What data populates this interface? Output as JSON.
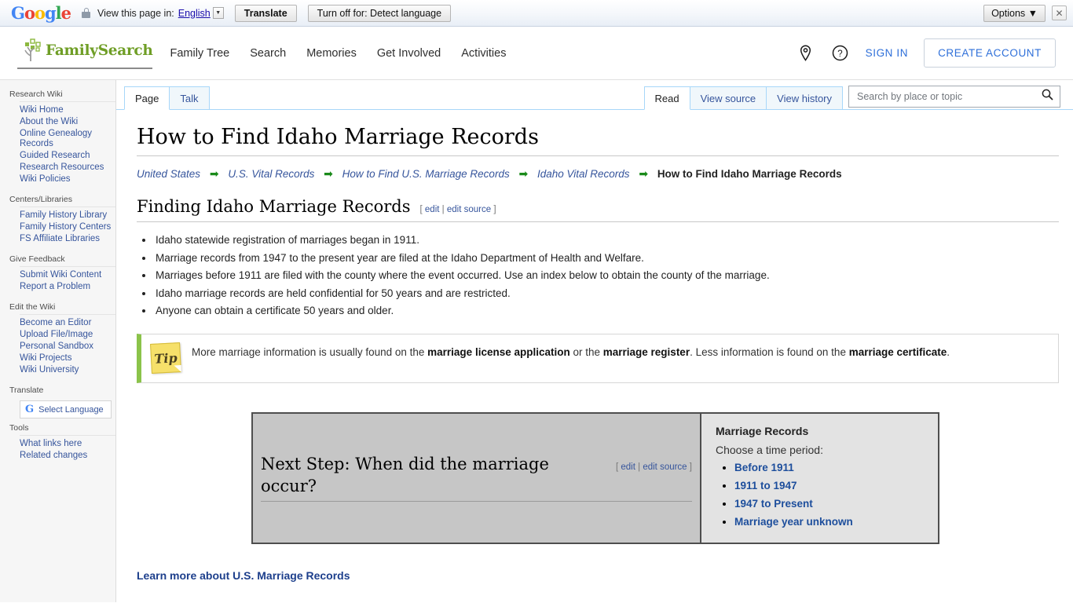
{
  "translate_bar": {
    "google_logo": "Google",
    "lock_icon": "lock-icon",
    "view_label": "View this page in:",
    "language": "English",
    "translate_button": "Translate",
    "turnoff_button": "Turn off for: Detect language",
    "options_button": "Options ▼",
    "close_icon": "✕"
  },
  "header": {
    "brand": "FamilySearch",
    "nav": [
      {
        "label": "Family Tree"
      },
      {
        "label": "Search"
      },
      {
        "label": "Memories"
      },
      {
        "label": "Get Involved"
      },
      {
        "label": "Activities"
      }
    ],
    "location_icon": "map-pin-icon",
    "help_icon": "help-circle-icon",
    "sign_in": "SIGN IN",
    "create_account": "CREATE ACCOUNT"
  },
  "sidebar": {
    "groups": [
      {
        "title": "Research Wiki",
        "items": [
          {
            "label": "Wiki Home"
          },
          {
            "label": "About the Wiki"
          },
          {
            "label": "Online Genealogy Records"
          },
          {
            "label": "Guided Research"
          },
          {
            "label": "Research Resources"
          },
          {
            "label": "Wiki Policies"
          }
        ]
      },
      {
        "title": "Centers/Libraries",
        "items": [
          {
            "label": "Family History Library"
          },
          {
            "label": "Family History Centers"
          },
          {
            "label": "FS Affiliate Libraries"
          }
        ]
      },
      {
        "title": "Give Feedback",
        "items": [
          {
            "label": "Submit Wiki Content"
          },
          {
            "label": "Report a Problem"
          }
        ]
      },
      {
        "title": "Edit the Wiki",
        "items": [
          {
            "label": "Become an Editor"
          },
          {
            "label": "Upload File/Image"
          },
          {
            "label": "Personal Sandbox"
          },
          {
            "label": "Wiki Projects"
          },
          {
            "label": "Wiki University"
          }
        ]
      }
    ],
    "translate_title": "Translate",
    "select_language": "Select Language",
    "google_glyph": "G",
    "tools_title": "Tools",
    "tools_items": [
      {
        "label": "What links here"
      },
      {
        "label": "Related changes"
      }
    ]
  },
  "tabs": {
    "left": [
      {
        "label": "Page",
        "active": true
      },
      {
        "label": "Talk",
        "active": false
      }
    ],
    "right": [
      {
        "label": "Read",
        "active": true
      },
      {
        "label": "View source",
        "active": false
      },
      {
        "label": "View history",
        "active": false
      }
    ]
  },
  "search": {
    "placeholder": "Search by place or topic",
    "value": "",
    "icon": "search-icon"
  },
  "main": {
    "page_title": "How to Find Idaho Marriage Records",
    "breadcrumb": [
      {
        "label": "United States",
        "current": false
      },
      {
        "label": "U.S. Vital Records",
        "current": false
      },
      {
        "label": "How to Find U.S. Marriage Records",
        "current": false
      },
      {
        "label": "Idaho Vital Records",
        "current": false
      },
      {
        "label": "How to Find Idaho Marriage Records",
        "current": true
      }
    ],
    "breadcrumb_arrow": "➡",
    "section_title": "Finding Idaho Marriage Records",
    "edit_open": "[",
    "edit_label": "edit",
    "edit_sep": "|",
    "edit_source_label": "edit source",
    "edit_close": "]",
    "facts": [
      "Idaho statewide registration of marriages began in 1911.",
      "Marriage records from 1947 to the present year are filed at the Idaho Department of Health and Welfare.",
      "Marriages before 1911 are filed with the county where the event occurred. Use an index below to obtain the county of the marriage.",
      "Idaho marriage records are held confidential for 50 years and are restricted.",
      "Anyone can obtain a certificate 50 years and older."
    ],
    "tip": {
      "icon_label": "Tip",
      "text_1": "More marriage information is usually found on the ",
      "bold_1": "marriage license application",
      "text_2": " or the ",
      "bold_2": "marriage register",
      "text_3": ". Less information is found on the ",
      "bold_3": "marriage certificate",
      "text_4": "."
    },
    "decision": {
      "left_heading": "Next Step: When did the marriage occur?",
      "right_heading": "Marriage Records",
      "right_subtitle": "Choose a time period:",
      "right_links": [
        {
          "label": "Before 1911"
        },
        {
          "label": "1911 to 1947"
        },
        {
          "label": "1947 to Present"
        },
        {
          "label": "Marriage year unknown"
        }
      ]
    },
    "learn_more": "Learn more about U.S. Marriage Records"
  },
  "colors": {
    "brand_green": "#6f9e26",
    "link_blue": "#36559c",
    "accent_blue": "#2e6fd9",
    "tip_green": "#8bc34a",
    "arrow_green": "#1a8a1a"
  }
}
